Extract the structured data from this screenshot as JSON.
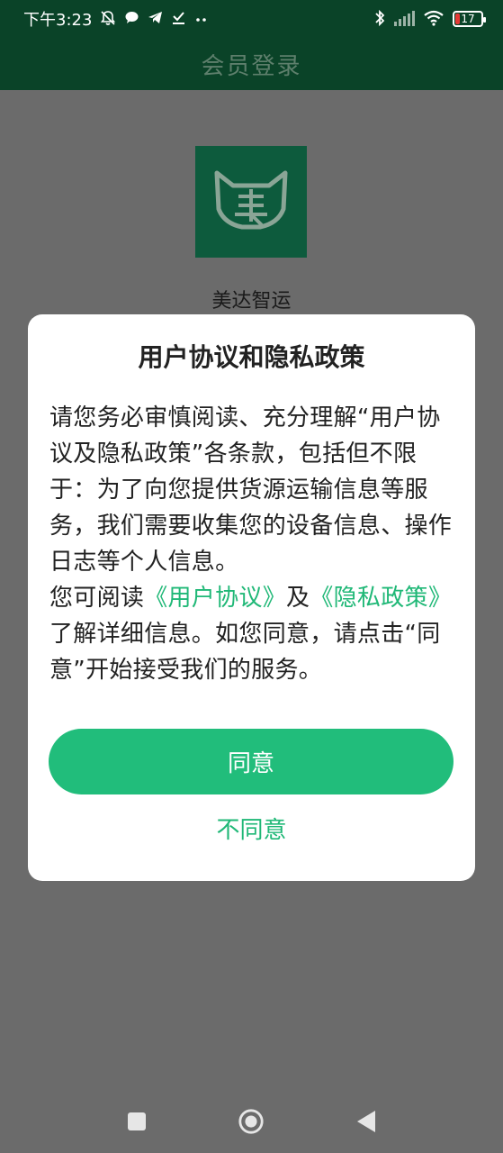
{
  "status_bar": {
    "time": "下午3:23",
    "battery_level": "17",
    "icons": [
      "mute-bell-icon",
      "chat-bubble-icon",
      "telegram-icon",
      "check-icon",
      "more-dots-icon",
      "bluetooth-icon",
      "signal-icon",
      "wifi-icon",
      "battery-icon"
    ]
  },
  "header": {
    "title": "会员登录"
  },
  "brand": {
    "name": "美达智运"
  },
  "dialog": {
    "title": "用户协议和隐私政策",
    "paragraph1": "请您务必审慎阅读、充分理解“用户协议及隐私政策”各条款，包括但不限于：为了向您提供货源运输信息等服务，我们需要收集您的设备信息、操作日志等个人信息。",
    "para2_prefix": "您可阅读",
    "user_agreement_link": "《用户协议》",
    "para2_and": "及",
    "privacy_policy_link": "《隐私政策》",
    "para2_suffix": "了解详细信息。如您同意，请点击“同意”开始接受我们的服务。",
    "agree_label": "同意",
    "disagree_label": "不同意"
  },
  "colors": {
    "header_bg": "#0a4328",
    "accent": "#21bd7b",
    "link": "#20b877",
    "overlay": "#6b6b6b"
  },
  "nav_bar": {
    "icons": [
      "recent-apps-icon",
      "home-icon",
      "back-icon"
    ]
  }
}
